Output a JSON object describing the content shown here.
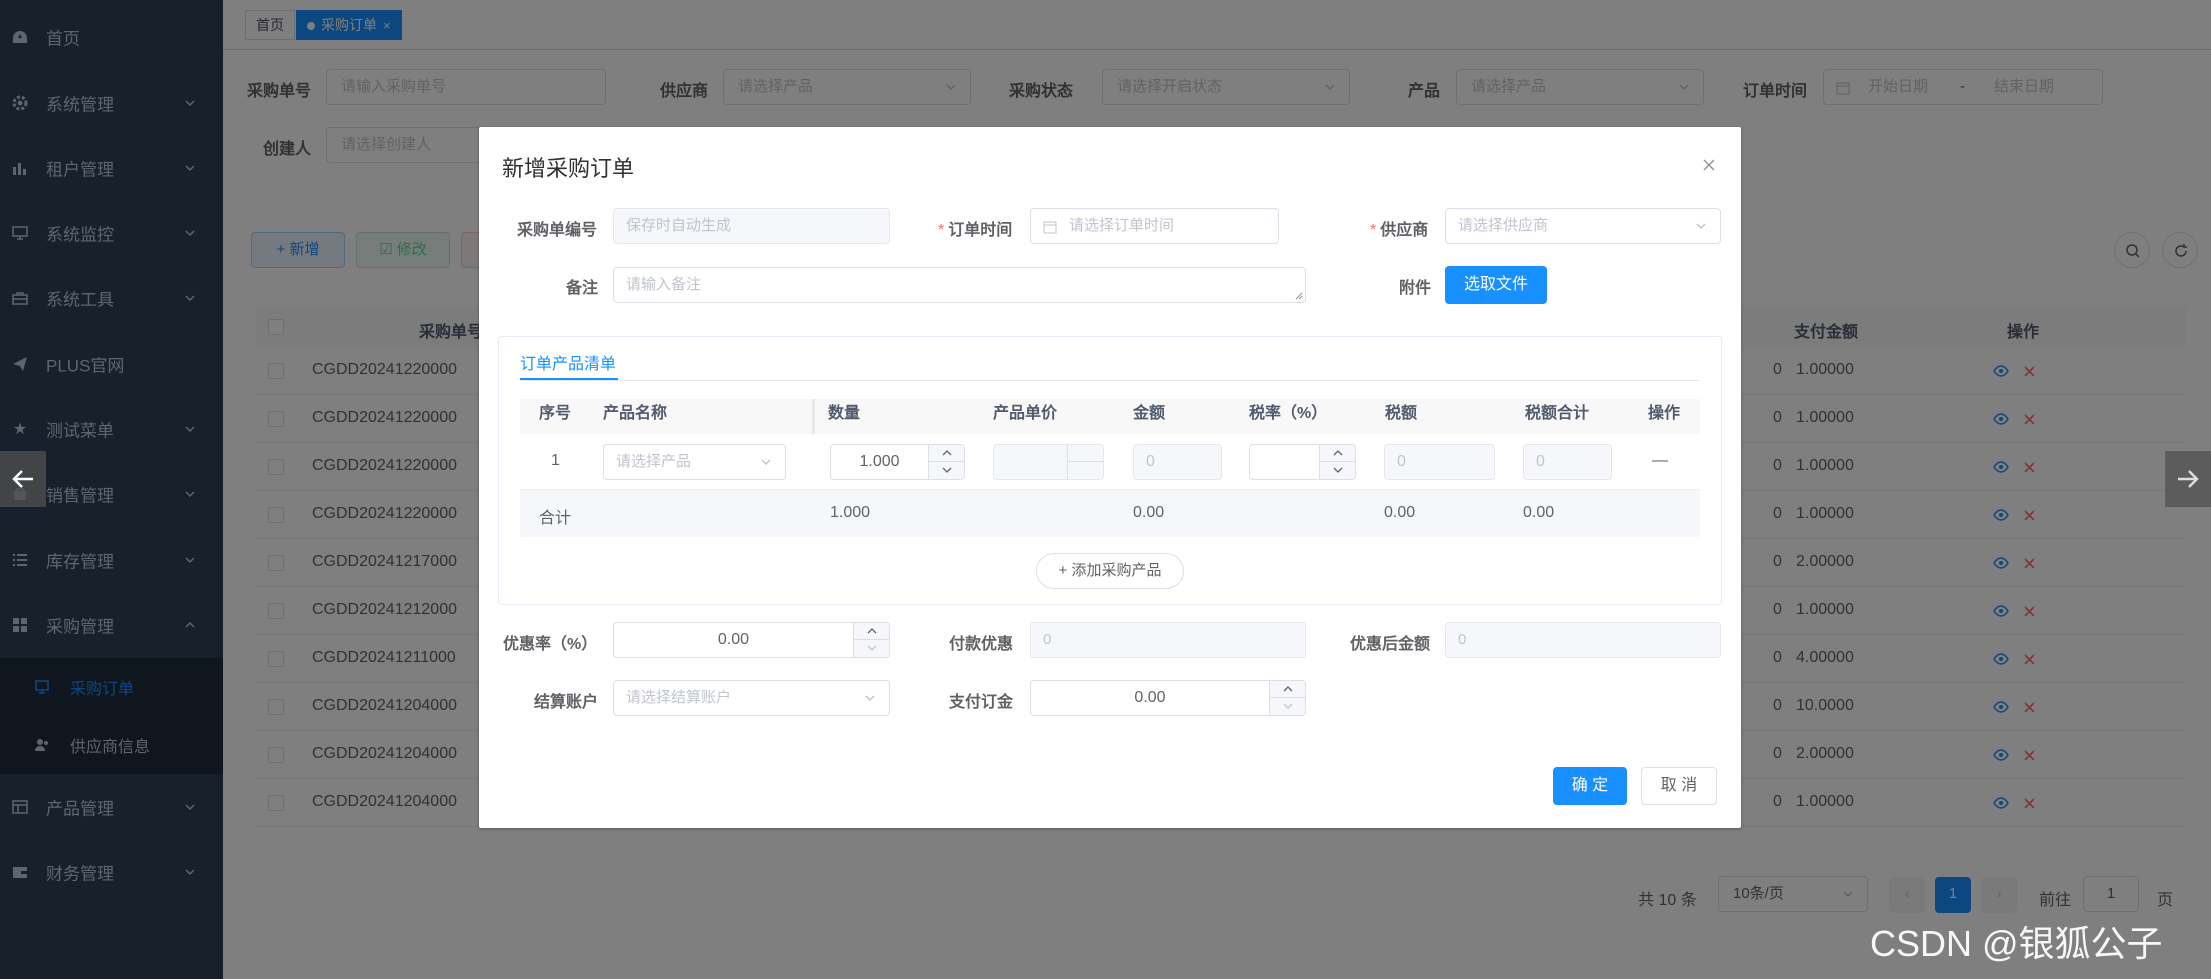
{
  "sidebar": {
    "items": [
      {
        "label": "首页",
        "icon": "dashboard-icon"
      },
      {
        "label": "系统管理",
        "icon": "gear-icon"
      },
      {
        "label": "租户管理",
        "icon": "chart-icon"
      },
      {
        "label": "系统监控",
        "icon": "monitor-icon"
      },
      {
        "label": "系统工具",
        "icon": "toolbox-icon"
      },
      {
        "label": "PLUS官网",
        "icon": "send-icon"
      },
      {
        "label": "测试菜单",
        "icon": "star-icon"
      },
      {
        "label": "销售管理",
        "icon": "bag-icon"
      },
      {
        "label": "库存管理",
        "icon": "list-icon"
      },
      {
        "label": "采购管理",
        "icon": "grid-icon"
      }
    ],
    "submenu": [
      {
        "label": "采购订单",
        "icon": "order-icon"
      },
      {
        "label": "供应商信息",
        "icon": "people-icon"
      }
    ],
    "bottom_items": [
      {
        "label": "产品管理",
        "icon": "product-icon"
      },
      {
        "label": "财务管理",
        "icon": "wallet-icon"
      }
    ]
  },
  "tags": {
    "home": "首页",
    "active": "采购订单"
  },
  "search": {
    "order_no_label": "采购单号",
    "order_no_placeholder": "请输入采购单号",
    "supplier_label": "供应商",
    "supplier_placeholder": "请选择产品",
    "status_label": "采购状态",
    "status_placeholder": "请选择开启状态",
    "product_label": "产品",
    "product_placeholder": "请选择产品",
    "time_label": "订单时间",
    "start_placeholder": "开始日期",
    "range_sep": "-",
    "end_placeholder": "结束日期",
    "creator_label": "创建人",
    "creator_placeholder": "请选择创建人"
  },
  "toolbar": {
    "add": "+ 新增",
    "edit": "修改"
  },
  "table": {
    "headers": {
      "order_no": "采购单号",
      "pay_amount": "支付金额",
      "actions": "操作"
    },
    "rows": [
      {
        "order_no": "CGDD20241220000",
        "pay": "1.00000"
      },
      {
        "order_no": "CGDD20241220000",
        "pay": "1.00000"
      },
      {
        "order_no": "CGDD20241220000",
        "pay": "1.00000"
      },
      {
        "order_no": "CGDD20241220000",
        "pay": "1.00000"
      },
      {
        "order_no": "CGDD20241217000",
        "pay": "2.00000"
      },
      {
        "order_no": "CGDD20241212000",
        "pay": "1.00000"
      },
      {
        "order_no": "CGDD20241211000",
        "pay": "4.00000"
      },
      {
        "order_no": "CGDD20241204000",
        "pay": "10.0000"
      },
      {
        "order_no": "CGDD20241204000",
        "pay": "2.00000"
      },
      {
        "order_no": "CGDD20241204000",
        "pay": "1.00000"
      }
    ],
    "row_cut_digit": "0"
  },
  "pagination": {
    "total": "共 10 条",
    "page_size": "10条/页",
    "current": "1",
    "goto_label": "前往",
    "goto_value": "1",
    "page_unit": "页"
  },
  "dialog": {
    "title": "新增采购订单",
    "order_no_label": "采购单编号",
    "order_no_placeholder": "保存时自动生成",
    "order_time_label": "订单时间",
    "order_time_placeholder": "请选择订单时间",
    "supplier_label": "供应商",
    "supplier_placeholder": "请选择供应商",
    "remark_label": "备注",
    "remark_placeholder": "请输入备注",
    "attachment_label": "附件",
    "select_file": "选取文件",
    "tab_label": "订单产品清单",
    "columns": [
      "序号",
      "产品名称",
      "数量",
      "产品单价",
      "金额",
      "税率（%）",
      "税额",
      "税额合计",
      "操作"
    ],
    "row": {
      "index": "1",
      "product_placeholder": "请选择产品",
      "quantity": "1.000",
      "amount": "0",
      "tax_amount": "0",
      "tax_total": "0",
      "action": "—"
    },
    "summary": {
      "label": "合计",
      "quantity": "1.000",
      "amount": "0.00",
      "tax": "0.00",
      "tax_total": "0.00"
    },
    "add_product": "+ 添加采购产品",
    "discount_rate_label": "优惠率（%）",
    "discount_rate_value": "0.00",
    "payment_discount_label": "付款优惠",
    "payment_discount_value": "0",
    "after_discount_label": "优惠后金额",
    "after_discount_value": "0",
    "account_label": "结算账户",
    "account_placeholder": "请选择结算账户",
    "deposit_label": "支付订金",
    "deposit_value": "0.00",
    "confirm": "确 定",
    "cancel": "取 消"
  },
  "watermark": "CSDN @银狐公子",
  "colors": {
    "primary": "#1890ff",
    "sidebar": "#304156",
    "danger": "#f56c6c"
  }
}
